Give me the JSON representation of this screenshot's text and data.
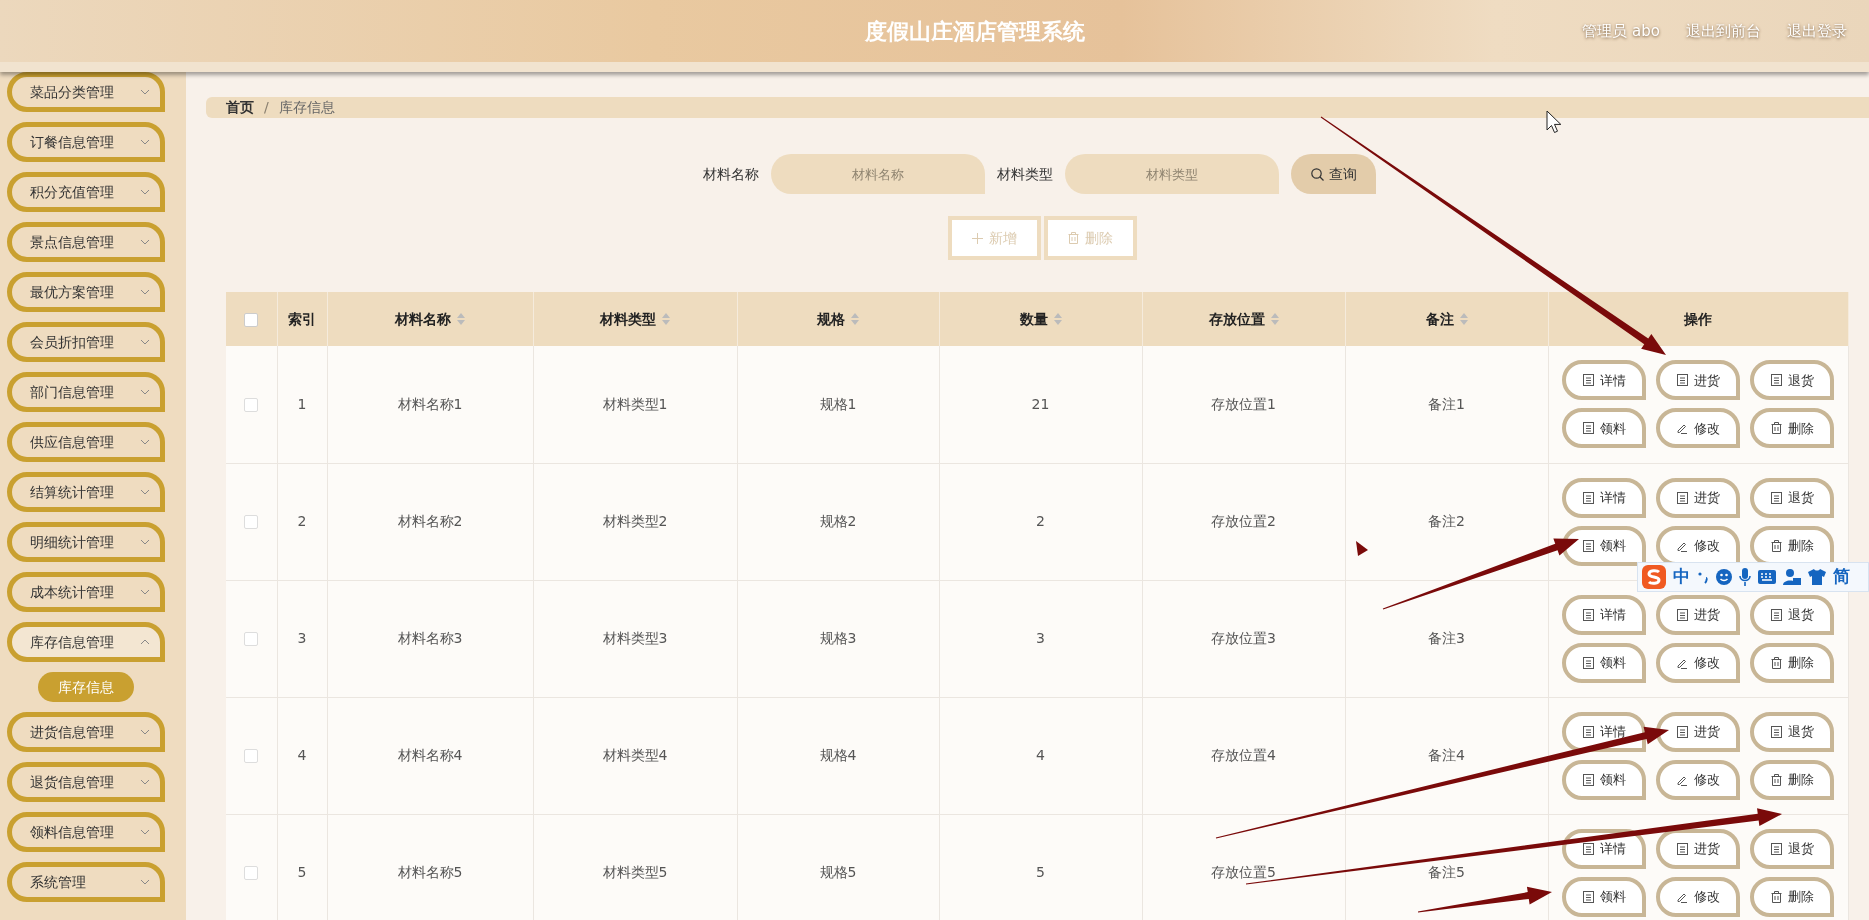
{
  "header": {
    "title": "度假山庄酒店管理系统",
    "user": "管理员 abo",
    "links": [
      "退出到前台",
      "退出登录"
    ]
  },
  "sidebar": {
    "items": [
      {
        "label": "菜品分类管理",
        "expanded": false
      },
      {
        "label": "订餐信息管理",
        "expanded": false
      },
      {
        "label": "积分充值管理",
        "expanded": false
      },
      {
        "label": "景点信息管理",
        "expanded": false
      },
      {
        "label": "最优方案管理",
        "expanded": false
      },
      {
        "label": "会员折扣管理",
        "expanded": false
      },
      {
        "label": "部门信息管理",
        "expanded": false
      },
      {
        "label": "供应信息管理",
        "expanded": false
      },
      {
        "label": "结算统计管理",
        "expanded": false
      },
      {
        "label": "明细统计管理",
        "expanded": false
      },
      {
        "label": "成本统计管理",
        "expanded": false
      },
      {
        "label": "库存信息管理",
        "expanded": true,
        "children": [
          {
            "label": "库存信息",
            "selected": true
          }
        ]
      },
      {
        "label": "进货信息管理",
        "expanded": false
      },
      {
        "label": "退货信息管理",
        "expanded": false
      },
      {
        "label": "领料信息管理",
        "expanded": false
      },
      {
        "label": "系统管理",
        "expanded": false
      }
    ]
  },
  "breadcrumb": {
    "items": [
      "首页",
      "库存信息"
    ],
    "separator": "/"
  },
  "search": {
    "fields": [
      {
        "label": "材料名称",
        "placeholder": "材料名称"
      },
      {
        "label": "材料类型",
        "placeholder": "材料类型"
      }
    ],
    "button": "查询"
  },
  "actions": [
    {
      "label": "新增",
      "kind": "add",
      "disabled": true
    },
    {
      "label": "删除",
      "kind": "delete",
      "disabled": true
    }
  ],
  "table": {
    "select_all": {
      "checked": false
    },
    "columns": [
      {
        "label": "索引",
        "sortable": false
      },
      {
        "label": "材料名称",
        "sortable": true
      },
      {
        "label": "材料类型",
        "sortable": true
      },
      {
        "label": "规格",
        "sortable": true
      },
      {
        "label": "数量",
        "sortable": true
      },
      {
        "label": "存放位置",
        "sortable": true
      },
      {
        "label": "备注",
        "sortable": true
      },
      {
        "label": "操作",
        "sortable": false
      }
    ],
    "rows": [
      {
        "checked": false,
        "cells": [
          "1",
          "材料名称1",
          "材料类型1",
          "规格1",
          "21",
          "存放位置1",
          "备注1"
        ],
        "actions": [
          {
            "label": "详情",
            "kind": "doc"
          },
          {
            "label": "进货",
            "kind": "doc"
          },
          {
            "label": "退货",
            "kind": "doc"
          },
          {
            "label": "领料",
            "kind": "doc"
          },
          {
            "label": "修改",
            "kind": "edit"
          },
          {
            "label": "删除",
            "kind": "delete"
          }
        ]
      },
      {
        "checked": false,
        "cells": [
          "2",
          "材料名称2",
          "材料类型2",
          "规格2",
          "2",
          "存放位置2",
          "备注2"
        ],
        "actions": [
          {
            "label": "详情",
            "kind": "doc"
          },
          {
            "label": "进货",
            "kind": "doc"
          },
          {
            "label": "退货",
            "kind": "doc"
          },
          {
            "label": "领料",
            "kind": "doc"
          },
          {
            "label": "修改",
            "kind": "edit"
          },
          {
            "label": "删除",
            "kind": "delete"
          }
        ]
      },
      {
        "checked": false,
        "cells": [
          "3",
          "材料名称3",
          "材料类型3",
          "规格3",
          "3",
          "存放位置3",
          "备注3"
        ],
        "actions": [
          {
            "label": "详情",
            "kind": "doc"
          },
          {
            "label": "进货",
            "kind": "doc"
          },
          {
            "label": "退货",
            "kind": "doc"
          },
          {
            "label": "领料",
            "kind": "doc"
          },
          {
            "label": "修改",
            "kind": "edit"
          },
          {
            "label": "删除",
            "kind": "delete"
          }
        ]
      },
      {
        "checked": false,
        "cells": [
          "4",
          "材料名称4",
          "材料类型4",
          "规格4",
          "4",
          "存放位置4",
          "备注4"
        ],
        "actions": [
          {
            "label": "详情",
            "kind": "doc"
          },
          {
            "label": "进货",
            "kind": "doc"
          },
          {
            "label": "退货",
            "kind": "doc"
          },
          {
            "label": "领料",
            "kind": "doc"
          },
          {
            "label": "修改",
            "kind": "edit"
          },
          {
            "label": "删除",
            "kind": "delete"
          }
        ]
      },
      {
        "checked": false,
        "cells": [
          "5",
          "材料名称5",
          "材料类型5",
          "规格5",
          "5",
          "存放位置5",
          "备注5"
        ],
        "actions": [
          {
            "label": "详情",
            "kind": "doc"
          },
          {
            "label": "进货",
            "kind": "doc"
          },
          {
            "label": "退货",
            "kind": "doc"
          },
          {
            "label": "领料",
            "kind": "doc"
          },
          {
            "label": "修改",
            "kind": "edit"
          },
          {
            "label": "删除",
            "kind": "delete"
          }
        ]
      }
    ]
  },
  "ime_toolbar": {
    "labels": [
      "中",
      "简"
    ]
  }
}
